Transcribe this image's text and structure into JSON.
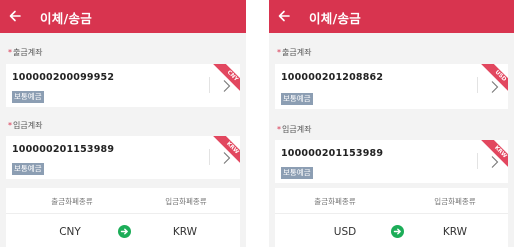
{
  "screens": [
    {
      "title": "이체/송금",
      "required_mark": "*",
      "from_label": "출금계좌",
      "from_account": {
        "number": "100000200099952",
        "type": "보통예금",
        "currency": "CNY"
      },
      "to_label": "입금계좌",
      "to_account": {
        "number": "100000201153989",
        "type": "보통예금",
        "currency": "KRW"
      },
      "exchange": {
        "from_header": "출금화폐종류",
        "to_header": "입금화폐종류",
        "from_currency": "CNY",
        "to_currency": "KRW"
      }
    },
    {
      "title": "이체/송금",
      "required_mark": "*",
      "from_label": "출금계좌",
      "from_account": {
        "number": "100000201208862",
        "type": "보통예금",
        "currency": "USD"
      },
      "to_label": "입금계좌",
      "to_account": {
        "number": "100000201153989",
        "type": "보통예금",
        "currency": "KRW"
      },
      "exchange": {
        "from_header": "출금화폐종류",
        "to_header": "입금화폐종류",
        "from_currency": "USD",
        "to_currency": "KRW"
      }
    }
  ],
  "colors": {
    "accent": "#d8344f",
    "ribbon": "#e2475f",
    "badge": "#8c9eb3",
    "exchange_icon": "#1cad58",
    "background": "#f3f3f3"
  },
  "icons": {
    "back": "back-arrow-icon",
    "chevron": "chevron-right-icon",
    "exchange": "exchange-arrow-icon"
  }
}
